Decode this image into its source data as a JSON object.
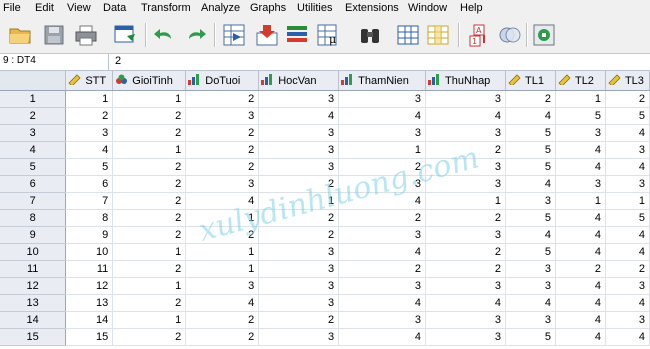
{
  "menu": [
    "File",
    "Edit",
    "View",
    "Data",
    "Transform",
    "Analyze",
    "Graphs",
    "Utilities",
    "Extensions",
    "Window",
    "Help"
  ],
  "cell_editor": {
    "ref": "9 : DT4",
    "value": "2"
  },
  "columns": [
    {
      "name": "STT",
      "icon": "scale-ruler-icon"
    },
    {
      "name": "GioiTinh",
      "icon": "nominal-circles-icon"
    },
    {
      "name": "DoTuoi",
      "icon": "ordinal-bars-icon"
    },
    {
      "name": "HocVan",
      "icon": "ordinal-bars-icon"
    },
    {
      "name": "ThamNien",
      "icon": "ordinal-bars-icon"
    },
    {
      "name": "ThuNhap",
      "icon": "ordinal-bars-icon"
    },
    {
      "name": "TL1",
      "icon": "scale-ruler-icon"
    },
    {
      "name": "TL2",
      "icon": "scale-ruler-icon"
    },
    {
      "name": "TL3",
      "icon": "scale-ruler-icon"
    }
  ],
  "rows": [
    {
      "n": "1",
      "v": [
        "1",
        "1",
        "2",
        "3",
        "3",
        "3",
        "2",
        "1",
        "2"
      ]
    },
    {
      "n": "2",
      "v": [
        "2",
        "2",
        "3",
        "4",
        "4",
        "4",
        "4",
        "5",
        "5"
      ]
    },
    {
      "n": "3",
      "v": [
        "3",
        "2",
        "2",
        "3",
        "3",
        "3",
        "5",
        "3",
        "4"
      ]
    },
    {
      "n": "4",
      "v": [
        "4",
        "1",
        "2",
        "3",
        "1",
        "2",
        "5",
        "4",
        "3"
      ]
    },
    {
      "n": "5",
      "v": [
        "5",
        "2",
        "2",
        "3",
        "2",
        "3",
        "5",
        "4",
        "4"
      ]
    },
    {
      "n": "6",
      "v": [
        "6",
        "2",
        "3",
        "2",
        "3",
        "3",
        "4",
        "3",
        "3"
      ]
    },
    {
      "n": "7",
      "v": [
        "7",
        "2",
        "4",
        "1",
        "4",
        "1",
        "3",
        "1",
        "1"
      ]
    },
    {
      "n": "8",
      "v": [
        "8",
        "2",
        "1",
        "2",
        "2",
        "2",
        "5",
        "4",
        "5"
      ]
    },
    {
      "n": "9",
      "v": [
        "9",
        "2",
        "2",
        "2",
        "3",
        "3",
        "4",
        "4",
        "4"
      ]
    },
    {
      "n": "10",
      "v": [
        "10",
        "1",
        "1",
        "3",
        "4",
        "2",
        "5",
        "4",
        "4"
      ]
    },
    {
      "n": "11",
      "v": [
        "11",
        "2",
        "1",
        "3",
        "2",
        "2",
        "3",
        "2",
        "2"
      ]
    },
    {
      "n": "12",
      "v": [
        "12",
        "1",
        "3",
        "3",
        "3",
        "3",
        "3",
        "4",
        "3"
      ]
    },
    {
      "n": "13",
      "v": [
        "13",
        "2",
        "4",
        "3",
        "4",
        "4",
        "4",
        "4",
        "4"
      ]
    },
    {
      "n": "14",
      "v": [
        "14",
        "1",
        "2",
        "2",
        "3",
        "3",
        "3",
        "4",
        "3"
      ]
    },
    {
      "n": "15",
      "v": [
        "15",
        "2",
        "2",
        "3",
        "4",
        "3",
        "5",
        "4",
        "4"
      ]
    }
  ],
  "watermark": "xulydinhluong.com",
  "colors": {
    "header_bg": "#e9edf3",
    "grid_line": "#dde2ea",
    "watermark": "#7fd2e8"
  }
}
